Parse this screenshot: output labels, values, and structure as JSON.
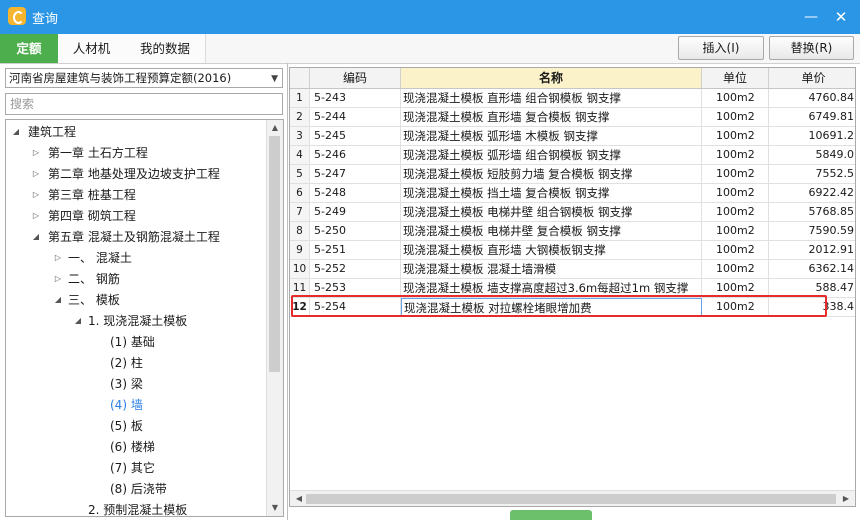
{
  "window": {
    "title": "查询",
    "minimize": "—",
    "close": "✕"
  },
  "tabs": [
    {
      "label": "定额"
    },
    {
      "label": "人材机"
    },
    {
      "label": "我的数据"
    }
  ],
  "actions": {
    "insert": "插入(I)",
    "replace": "替换(R)"
  },
  "library": {
    "selected": "河南省房屋建筑与装饰工程预算定额(2016)"
  },
  "search": {
    "placeholder": "搜索"
  },
  "tree": [
    {
      "label": "建筑工程",
      "twisty": "◢"
    },
    {
      "label": "第一章  土石方工程",
      "twisty": "▷"
    },
    {
      "label": "第二章  地基处理及边坡支护工程",
      "twisty": "▷"
    },
    {
      "label": "第三章  桩基工程",
      "twisty": "▷"
    },
    {
      "label": "第四章  砌筑工程",
      "twisty": "▷"
    },
    {
      "label": "第五章  混凝土及钢筋混凝土工程",
      "twisty": "◢"
    },
    {
      "label": "一、  混凝土",
      "twisty": "▷"
    },
    {
      "label": "二、  钢筋",
      "twisty": "▷"
    },
    {
      "label": "三、  模板",
      "twisty": "◢"
    },
    {
      "label": "1. 现浇混凝土模板",
      "twisty": "◢"
    },
    {
      "label": "(1) 基础",
      "twisty": ""
    },
    {
      "label": "(2) 柱",
      "twisty": ""
    },
    {
      "label": "(3) 梁",
      "twisty": ""
    },
    {
      "label": "(4) 墙",
      "twisty": ""
    },
    {
      "label": "(5) 板",
      "twisty": ""
    },
    {
      "label": "(6) 楼梯",
      "twisty": ""
    },
    {
      "label": "(7) 其它",
      "twisty": ""
    },
    {
      "label": "(8) 后浇带",
      "twisty": ""
    },
    {
      "label": "2. 预制混凝土模板",
      "twisty": ""
    }
  ],
  "table": {
    "columns": [
      "编码",
      "名称",
      "单位",
      "单价"
    ],
    "rows": [
      {
        "num": "1",
        "code": "5-243",
        "name": "现浇混凝土模板 直形墙 组合钢模板 钢支撑",
        "unit": "100m2",
        "price": "4760.84"
      },
      {
        "num": "2",
        "code": "5-244",
        "name": "现浇混凝土模板 直形墙 复合模板 钢支撑",
        "unit": "100m2",
        "price": "6749.81"
      },
      {
        "num": "3",
        "code": "5-245",
        "name": "现浇混凝土模板 弧形墙 木模板 钢支撑",
        "unit": "100m2",
        "price": "10691.2"
      },
      {
        "num": "4",
        "code": "5-246",
        "name": "现浇混凝土模板 弧形墙 组合钢模板 钢支撑",
        "unit": "100m2",
        "price": "5849.0"
      },
      {
        "num": "5",
        "code": "5-247",
        "name": "现浇混凝土模板 短肢剪力墙 复合模板 钢支撑",
        "unit": "100m2",
        "price": "7552.5"
      },
      {
        "num": "6",
        "code": "5-248",
        "name": "现浇混凝土模板 挡土墙 复合模板 钢支撑",
        "unit": "100m2",
        "price": "6922.42"
      },
      {
        "num": "7",
        "code": "5-249",
        "name": "现浇混凝土模板 电梯井壁 组合钢模板 钢支撑",
        "unit": "100m2",
        "price": "5768.85"
      },
      {
        "num": "8",
        "code": "5-250",
        "name": "现浇混凝土模板 电梯井壁 复合模板 钢支撑",
        "unit": "100m2",
        "price": "7590.59"
      },
      {
        "num": "9",
        "code": "5-251",
        "name": "现浇混凝土模板 直形墙 大钢模板钢支撑",
        "unit": "100m2",
        "price": "2012.91"
      },
      {
        "num": "10",
        "code": "5-252",
        "name": "现浇混凝土模板 混凝土墙滑模",
        "unit": "100m2",
        "price": "6362.14"
      },
      {
        "num": "11",
        "code": "5-253",
        "name": "现浇混凝土模板 墙支撑高度超过3.6m每超过1m 钢支撑",
        "unit": "100m2",
        "price": "588.47"
      },
      {
        "num": "12",
        "code": "5-254",
        "name": "现浇混凝土模板 对拉螺栓堵眼增加费",
        "unit": "100m2",
        "price": "338.4"
      }
    ]
  },
  "colors": {
    "titlebar": "#2b96e6",
    "active_tab": "#4cae4c",
    "highlight": "#e52b2b",
    "name_header": "#fbf2c9"
  }
}
